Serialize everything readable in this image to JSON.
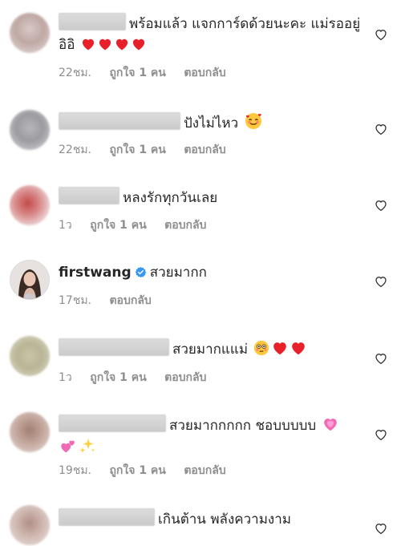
{
  "comments": [
    {
      "text": "พร้อมแล้ว แจกการ์ดด้วยนะคะ แม่รออยู่ อิอิ",
      "time": "22ชม.",
      "likes": "ถูกใจ 1 คน",
      "reply": "ตอบกลับ",
      "emoji": [
        "red-heart",
        "red-heart",
        "red-heart",
        "red-heart"
      ]
    },
    {
      "text": "ปังไม่ไหว",
      "time": "22ชม.",
      "likes": "ถูกใจ 1 คน",
      "reply": "ตอบกลับ",
      "emoji": [
        "smiling-face-with-hearts"
      ]
    },
    {
      "text": "หลงรักทุกวันเลย",
      "time": "1ว",
      "likes": "ถูกใจ 1 คน",
      "reply": "ตอบกลับ",
      "emoji": []
    },
    {
      "username": "firstwang",
      "verified": true,
      "text": "สวยมากก",
      "time": "17ชม.",
      "reply": "ตอบกลับ",
      "emoji": []
    },
    {
      "text": "สวยมากแแม่",
      "time": "1ว",
      "likes": "ถูกใจ 1 คน",
      "reply": "ตอบกลับ",
      "emoji": [
        "flushed-face",
        "red-heart",
        "red-heart"
      ]
    },
    {
      "text": "สวยมากกกกก ชอบบบบบ",
      "time": "19ชม.",
      "likes": "ถูกใจ 1 คน",
      "reply": "ตอบกลับ",
      "emoji": [
        "growing-heart",
        "two-hearts",
        "sparkles"
      ]
    },
    {
      "text": "เกินต้าน พลังความงาม",
      "emoji": []
    }
  ],
  "colors": {
    "text": "#262626",
    "meta": "#8e8e8e",
    "verified": "#3897f0",
    "heart_red": "#e8202a"
  }
}
